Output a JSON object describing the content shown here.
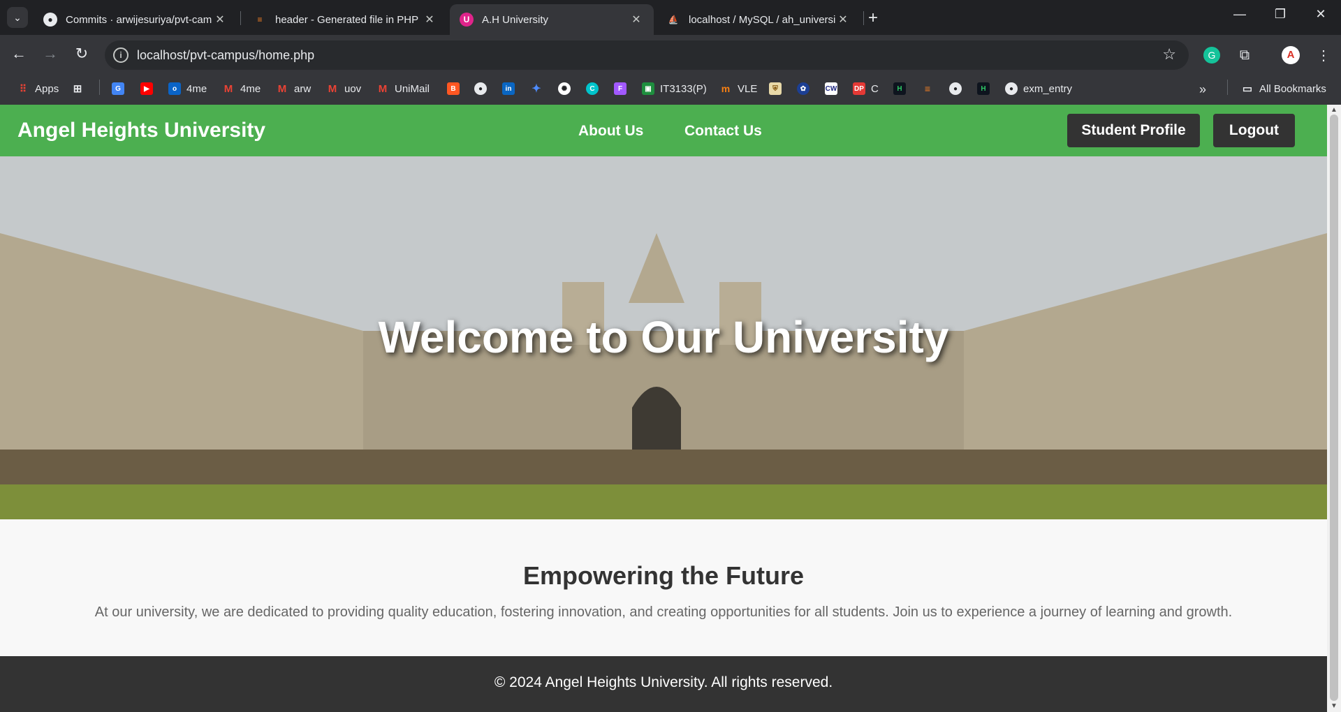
{
  "browser": {
    "tabs": [
      {
        "title": "Commits · arwijesuriya/pvt-campus",
        "icon": "github-icon",
        "active": false
      },
      {
        "title": "header - Generated file in PHP",
        "icon": "stackoverflow-icon",
        "active": false
      },
      {
        "title": "A.H University",
        "icon": "university-icon",
        "active": true
      },
      {
        "title": "localhost / MySQL / ah_university",
        "icon": "phpmyadmin-icon",
        "active": false
      }
    ],
    "address": "localhost/pvt-campus/home.php",
    "bookmarks": [
      {
        "label": "Apps",
        "icon": "apps-grid-icon"
      },
      {
        "label": "",
        "icon": "tab-groups-icon"
      },
      {
        "label": "",
        "icon": "google-translate-icon"
      },
      {
        "label": "",
        "icon": "youtube-icon"
      },
      {
        "label": "4me",
        "icon": "outlook-icon"
      },
      {
        "label": "4me",
        "icon": "gmail-icon"
      },
      {
        "label": "arw",
        "icon": "gmail-icon"
      },
      {
        "label": "uov",
        "icon": "gmail-icon"
      },
      {
        "label": "UniMail",
        "icon": "gmail-icon"
      },
      {
        "label": "",
        "icon": "blogger-icon"
      },
      {
        "label": "",
        "icon": "github-icon"
      },
      {
        "label": "",
        "icon": "linkedin-icon"
      },
      {
        "label": "",
        "icon": "gemini-icon"
      },
      {
        "label": "",
        "icon": "chatgpt-icon"
      },
      {
        "label": "",
        "icon": "canva-icon"
      },
      {
        "label": "",
        "icon": "figma-icon"
      },
      {
        "label": "IT3133(P)",
        "icon": "classroom-icon"
      },
      {
        "label": "VLE",
        "icon": "moodle-icon"
      },
      {
        "label": "",
        "icon": "crest-icon"
      },
      {
        "label": "",
        "icon": "seal-icon"
      },
      {
        "label": "",
        "icon": "cw-icon"
      },
      {
        "label": "C",
        "icon": "dp-icon"
      },
      {
        "label": "",
        "icon": "hackerrank-icon"
      },
      {
        "label": "",
        "icon": "stackoverflow-icon"
      },
      {
        "label": "",
        "icon": "github-icon"
      },
      {
        "label": "",
        "icon": "hackerrank-icon"
      },
      {
        "label": "exm_entry",
        "icon": "github-icon"
      }
    ],
    "all_bookmarks": "All Bookmarks"
  },
  "site": {
    "brand": "Angel Heights University",
    "nav": {
      "about": "About Us",
      "contact": "Contact Us"
    },
    "buttons": {
      "profile": "Student Profile",
      "logout": "Logout"
    },
    "hero_title": "Welcome to Our University",
    "intro_title": "Empowering the Future",
    "intro_text": "At our university, we are dedicated to providing quality education, fostering innovation, and creating opportunities for all students. Join us to experience a journey of learning and growth.",
    "footer": "© 2024 Angel Heights University. All rights reserved."
  },
  "colors": {
    "header": "#4caf50",
    "button": "#333333",
    "footer": "#333333",
    "chrome": "#202124"
  }
}
